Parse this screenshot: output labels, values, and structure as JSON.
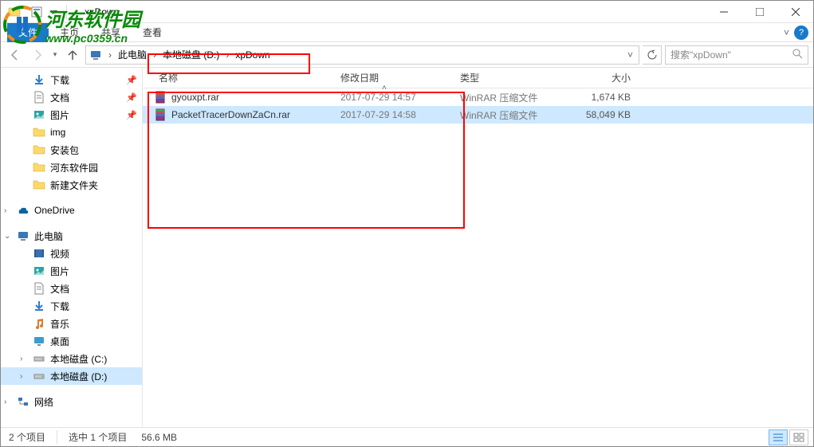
{
  "watermark": {
    "line1": "河东软件园",
    "line2": "www.pc0359.cn"
  },
  "title": "xpDown",
  "ribbon": {
    "file": "文件",
    "tabs": [
      "主页",
      "共享",
      "查看"
    ]
  },
  "breadcrumb": {
    "root": "此电脑",
    "segs": [
      "本地磁盘 (D:)",
      "xpDown"
    ]
  },
  "search": {
    "placeholder": "搜索\"xpDown\""
  },
  "nav": {
    "quick": [
      {
        "label": "下载",
        "icon": "download",
        "pinned": true
      },
      {
        "label": "文档",
        "icon": "document",
        "pinned": true
      },
      {
        "label": "图片",
        "icon": "picture",
        "pinned": true
      },
      {
        "label": "img",
        "icon": "folder"
      },
      {
        "label": "安装包",
        "icon": "folder"
      },
      {
        "label": "河东软件园",
        "icon": "folder"
      },
      {
        "label": "新建文件夹",
        "icon": "folder"
      }
    ],
    "onedrive": "OneDrive",
    "thispc": "此电脑",
    "thispc_children": [
      {
        "label": "视频",
        "icon": "video"
      },
      {
        "label": "图片",
        "icon": "picture"
      },
      {
        "label": "文档",
        "icon": "document"
      },
      {
        "label": "下载",
        "icon": "download"
      },
      {
        "label": "音乐",
        "icon": "music"
      },
      {
        "label": "桌面",
        "icon": "desktop"
      },
      {
        "label": "本地磁盘 (C:)",
        "icon": "drive"
      },
      {
        "label": "本地磁盘 (D:)",
        "icon": "drive",
        "selected": true
      }
    ],
    "network": "网络"
  },
  "columns": {
    "name": "名称",
    "date": "修改日期",
    "type": "类型",
    "size": "大小"
  },
  "files": [
    {
      "name": "gyouxpt.rar",
      "date": "2017-07-29 14:57",
      "type": "WinRAR 压缩文件",
      "size": "1,674 KB"
    },
    {
      "name": "PacketTracerDownZaCn.rar",
      "date": "2017-07-29 14:58",
      "type": "WinRAR 压缩文件",
      "size": "58,049 KB",
      "selected": true
    }
  ],
  "status": {
    "count": "2 个项目",
    "selected": "选中 1 个项目",
    "size": "56.6 MB"
  }
}
